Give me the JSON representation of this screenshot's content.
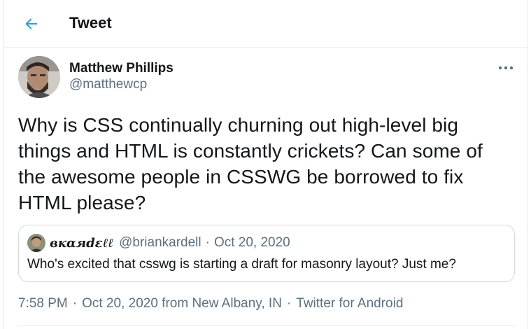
{
  "colors": {
    "accent": "#1da1f2",
    "text_primary": "#14171a",
    "text_secondary": "#5b7083",
    "border": "#e6ecf0"
  },
  "header": {
    "back_icon": "arrow-left-icon",
    "title": "Tweet"
  },
  "tweet": {
    "author": {
      "name": "Matthew Phillips",
      "handle": "@matthewcp"
    },
    "more_icon": "more-horizontal-icon",
    "text": "Why is CSS continually churning out high-level big things and HTML is constantly crickets? Can some of the awesome people in CSSWG be borrowed to fix HTML please?",
    "quoted": {
      "author_name": "вкαяdεℓℓ",
      "handle": "@briankardell",
      "separator": "·",
      "date": "Oct 20, 2020",
      "text": "Who's excited that csswg is starting a draft for masonry layout? Just me?"
    },
    "info": {
      "time": "7:58 PM",
      "date_location": "Oct 20, 2020 from New Albany, IN",
      "source": "Twitter for Android",
      "separator": "·"
    }
  }
}
